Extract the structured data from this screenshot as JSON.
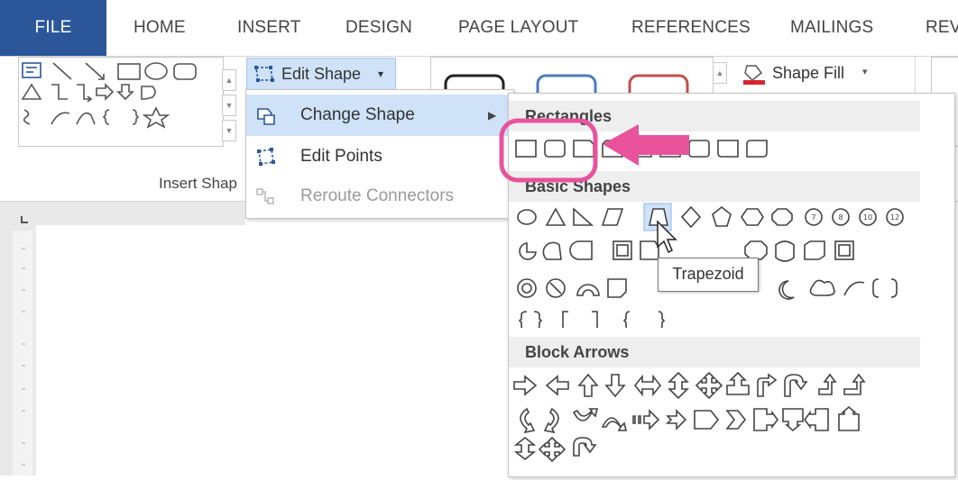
{
  "tabs": [
    "FILE",
    "HOME",
    "INSERT",
    "DESIGN",
    "PAGE LAYOUT",
    "REFERENCES",
    "MAILINGS",
    "REV"
  ],
  "ribbon": {
    "edit_shape_label": "Edit Shape",
    "insert_shapes_group": "Insert Shap",
    "shape_fill_label": "Shape Fill"
  },
  "menu": {
    "change_shape": "Change Shape",
    "edit_points": "Edit Points",
    "reroute_connectors": "Reroute Connectors"
  },
  "flyout": {
    "rectangles": "Rectangles",
    "basic_shapes": "Basic Shapes",
    "block_arrows": "Block Arrows"
  },
  "tooltip": "Trapezoid",
  "colors": {
    "file_tab": "#2b579a",
    "highlight": "#cfe2f8",
    "callout": "#e8539c"
  },
  "icons": [
    "edit-shape-icon",
    "change-shape-icon",
    "edit-points-icon",
    "reroute-connectors-icon",
    "shape-fill-icon",
    "submenu-arrow-icon",
    "callout-arrow"
  ]
}
